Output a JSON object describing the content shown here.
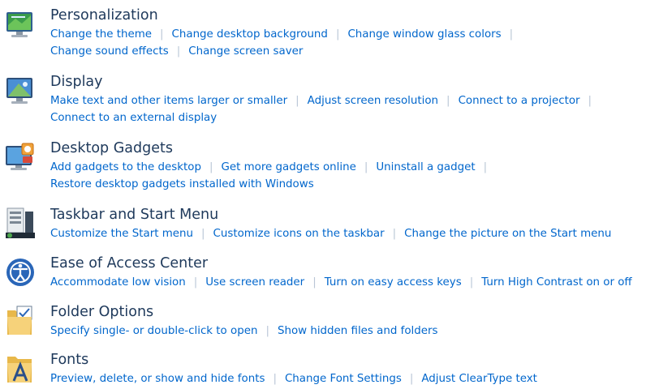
{
  "categories": [
    {
      "title": "Personalization",
      "icon": "personalization-icon",
      "lines": [
        [
          "Change the theme",
          "Change desktop background",
          "Change window glass colors"
        ],
        [
          "Change sound effects",
          "Change screen saver"
        ]
      ]
    },
    {
      "title": "Display",
      "icon": "display-icon",
      "lines": [
        [
          "Make text and other items larger or smaller",
          "Adjust screen resolution",
          "Connect to a projector"
        ],
        [
          "Connect to an external display"
        ]
      ]
    },
    {
      "title": "Desktop Gadgets",
      "icon": "desktop-gadgets-icon",
      "lines": [
        [
          "Add gadgets to the desktop",
          "Get more gadgets online",
          "Uninstall a gadget"
        ],
        [
          "Restore desktop gadgets installed with Windows"
        ]
      ]
    },
    {
      "title": "Taskbar and Start Menu",
      "icon": "taskbar-icon",
      "lines": [
        [
          "Customize the Start menu",
          "Customize icons on the taskbar",
          "Change the picture on the Start menu"
        ]
      ]
    },
    {
      "title": "Ease of Access Center",
      "icon": "ease-of-access-icon",
      "lines": [
        [
          "Accommodate low vision",
          "Use screen reader",
          "Turn on easy access keys",
          "Turn High Contrast on or off"
        ]
      ]
    },
    {
      "title": "Folder Options",
      "icon": "folder-options-icon",
      "lines": [
        [
          "Specify single- or double-click to open",
          "Show hidden files and folders"
        ]
      ]
    },
    {
      "title": "Fonts",
      "icon": "fonts-icon",
      "lines": [
        [
          "Preview, delete, or show and hide fonts",
          "Change Font Settings",
          "Adjust ClearType text"
        ]
      ]
    }
  ]
}
